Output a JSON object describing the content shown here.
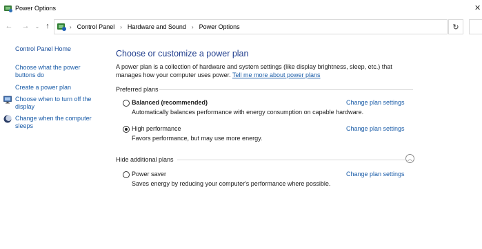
{
  "window": {
    "title": "Power Options",
    "icon": "power-options-icon"
  },
  "address_bar": {
    "icon": "control-panel-icon",
    "breadcrumbs": [
      "Control Panel",
      "Hardware and Sound",
      "Power Options"
    ],
    "separator": "›"
  },
  "nav": {
    "back_icon": "arrow-left-icon",
    "forward_icon": "arrow-right-icon",
    "recent_icon": "chevron-down-icon",
    "up_icon": "arrow-up-icon",
    "refresh_icon": "refresh-icon"
  },
  "sidebar": {
    "home": "Control Panel Home",
    "items": [
      {
        "label": "Choose what the power buttons do"
      },
      {
        "label": "Create a power plan"
      },
      {
        "label": "Choose when to turn off the display",
        "icon": "monitor-icon"
      },
      {
        "label": "Change when the computer sleeps",
        "icon": "moon-icon"
      }
    ]
  },
  "main": {
    "title": "Choose or customize a power plan",
    "description": "A power plan is a collection of hardware and system settings (like display brightness, sleep, etc.) that manages how your computer uses power.",
    "learn_more_link": "Tell me more about power plans",
    "preferred_header": "Preferred plans",
    "additional_header": "Hide additional plans",
    "plans": [
      {
        "name": "Balanced (recommended)",
        "description": "Automatically balances performance with energy consumption on capable hardware.",
        "link": "Change plan settings",
        "selected": false
      },
      {
        "name": "High performance",
        "description": "Favors performance, but may use more energy.",
        "link": "Change plan settings",
        "selected": true
      },
      {
        "name": "Power saver",
        "description": "Saves energy by reducing your computer's performance where possible.",
        "link": "Change plan settings",
        "selected": false
      }
    ]
  },
  "colors": {
    "link": "#1a5ca8",
    "title": "#1e3c8c"
  }
}
